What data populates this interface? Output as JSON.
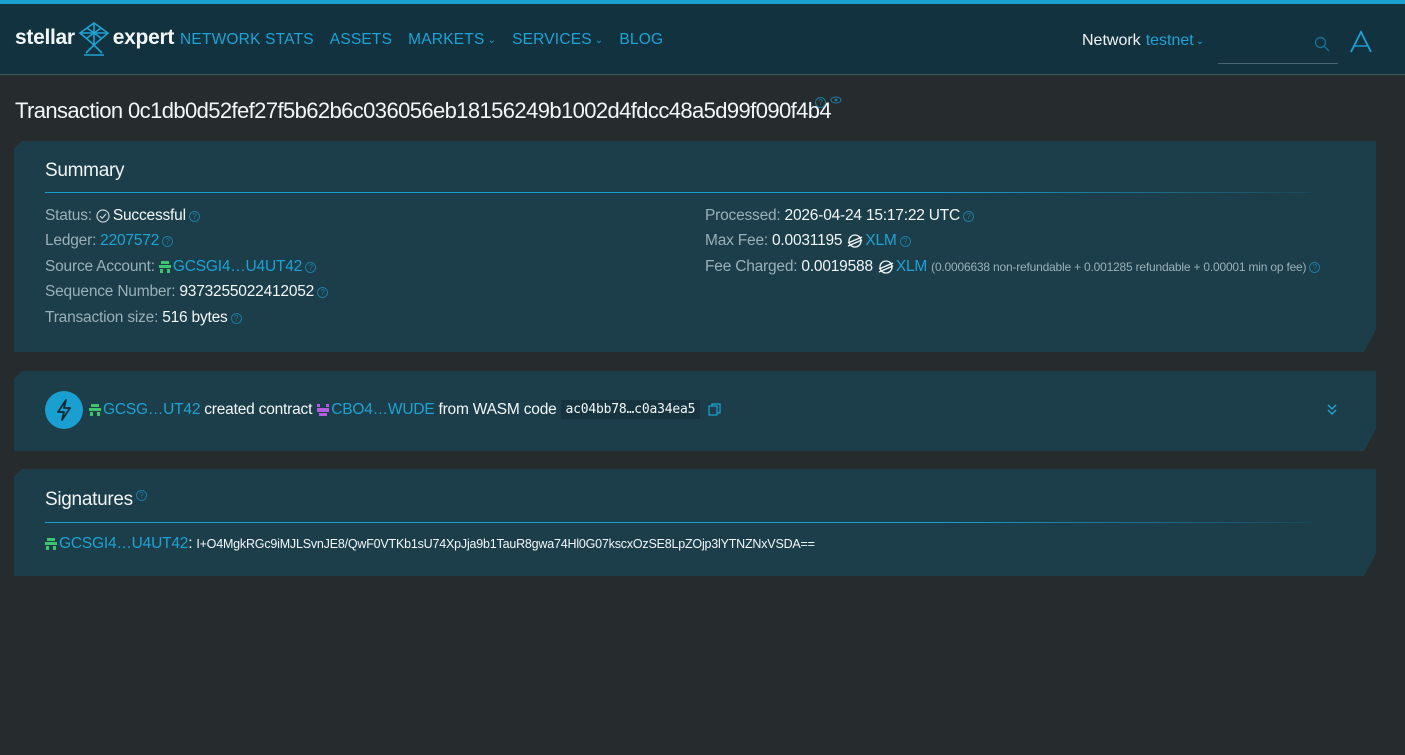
{
  "header": {
    "logo_left": "stellar",
    "logo_right": "expert",
    "nav": [
      {
        "label": "NETWORK STATS",
        "dropdown": false
      },
      {
        "label": "ASSETS",
        "dropdown": false
      },
      {
        "label": "MARKETS",
        "dropdown": true
      },
      {
        "label": "SERVICES",
        "dropdown": true
      },
      {
        "label": "BLOG",
        "dropdown": false
      }
    ],
    "network_label": "Network",
    "network_value": "testnet",
    "search_placeholder": ""
  },
  "title": {
    "text": "Transaction 0c1db0d52fef27f5b62b6c036056eb18156249b1002d4fdcc48a5d99f090f4b4"
  },
  "summary": {
    "title": "Summary",
    "status_label": "Status:",
    "status_value": "Successful",
    "ledger_label": "Ledger:",
    "ledger_value": "2207572",
    "source_label": "Source Account:",
    "source_value": "GCSGI4…U4UT42",
    "sequence_label": "Sequence Number:",
    "sequence_value": "9373255022412052",
    "size_label": "Transaction size:",
    "size_value": "516 bytes",
    "processed_label": "Processed:",
    "processed_value": "2026-04-24 15:17:22 UTC",
    "maxfee_label": "Max Fee:",
    "maxfee_value": "0.0031195",
    "maxfee_asset": "XLM",
    "charged_label": "Fee Charged:",
    "charged_value": "0.0019588",
    "charged_asset": "XLM",
    "charged_breakdown": "(0.0006638 non-refundable + 0.001285 refundable + 0.00001 min op fee)"
  },
  "operation": {
    "account": "GCSG…UT42",
    "action": "created contract",
    "contract": "CBO4…WUDE",
    "from_text": "from WASM code",
    "wasm_hash": "ac04bb78…c0a34ea5"
  },
  "signatures": {
    "title": "Signatures",
    "items": [
      {
        "account": "GCSGI4…U4UT42",
        "value": "I+O4MgkRGc9iMJLSvnJE8/QwF0VTKb1sU74XpJja9b1TauR8gwa74Hl0G07kscxOzSE8LpZOjp3lYTNZNxVSDA=="
      }
    ]
  },
  "colors": {
    "accent": "#1a9fd1",
    "link": "#1fa2d4",
    "account_green": "#3ec46d",
    "contract_purple": "#b45de0",
    "panel": "#1b3e4a",
    "background": "#262b2e"
  },
  "icons": {
    "logo": "satellite-dish-icon",
    "search": "search-icon",
    "account": "account-avatar-icon",
    "status": "check-circle-icon",
    "xlm": "stellar-lumen-icon",
    "operation": "lightning-icon",
    "copy": "copy-icon",
    "expand": "double-chevron-down-icon"
  }
}
